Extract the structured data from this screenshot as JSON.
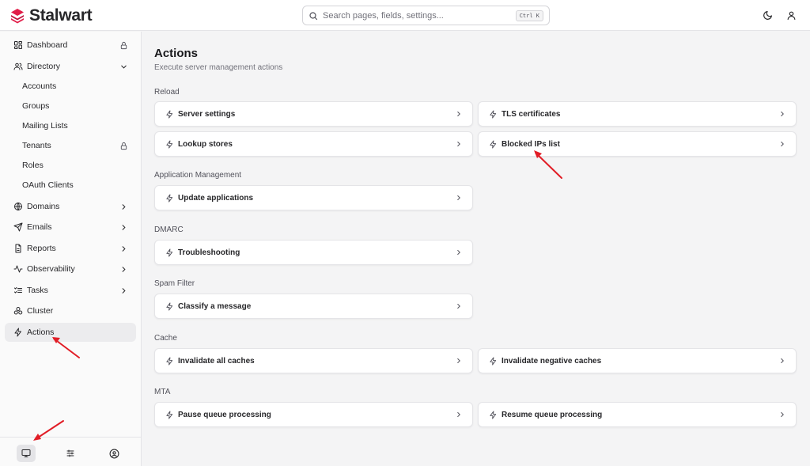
{
  "app": {
    "name": "Stalwart",
    "brand_color": "#e11d48"
  },
  "search": {
    "placeholder": "Search pages, fields, settings...",
    "shortcut": "Ctrl K"
  },
  "header": {
    "icons": [
      "moon-icon",
      "user-icon"
    ]
  },
  "sidebar": {
    "items": [
      {
        "label": "Dashboard",
        "icon": "dashboard-icon",
        "right": "lock-icon"
      },
      {
        "label": "Directory",
        "icon": "users-icon",
        "right": "chevron-down-icon"
      },
      {
        "label": "Accounts"
      },
      {
        "label": "Groups"
      },
      {
        "label": "Mailing Lists"
      },
      {
        "label": "Tenants",
        "right": "lock-icon"
      },
      {
        "label": "Roles"
      },
      {
        "label": "OAuth Clients"
      },
      {
        "label": "Domains",
        "icon": "globe-icon",
        "right": "chevron-right-icon"
      },
      {
        "label": "Emails",
        "icon": "send-icon",
        "right": "chevron-right-icon"
      },
      {
        "label": "Reports",
        "icon": "file-icon",
        "right": "chevron-right-icon"
      },
      {
        "label": "Observability",
        "icon": "activity-icon",
        "right": "chevron-right-icon"
      },
      {
        "label": "Tasks",
        "icon": "list-checks-icon",
        "right": "chevron-right-icon"
      },
      {
        "label": "Cluster",
        "icon": "cluster-icon"
      },
      {
        "label": "Actions",
        "icon": "zap-icon",
        "active": true
      }
    ],
    "footer": [
      "monitor-icon",
      "sliders-icon",
      "user-circle-icon"
    ]
  },
  "main": {
    "title": "Actions",
    "subtitle": "Execute server management actions",
    "sections": [
      {
        "label": "Reload",
        "actions": [
          "Server settings",
          "TLS certificates",
          "Lookup stores",
          "Blocked IPs list"
        ]
      },
      {
        "label": "Application Management",
        "actions": [
          "Update applications"
        ]
      },
      {
        "label": "DMARC",
        "actions": [
          "Troubleshooting"
        ]
      },
      {
        "label": "Spam Filter",
        "actions": [
          "Classify a message"
        ]
      },
      {
        "label": "Cache",
        "actions": [
          "Invalidate all caches",
          "Invalidate negative caches"
        ]
      },
      {
        "label": "MTA",
        "actions": [
          "Pause queue processing",
          "Resume queue processing"
        ]
      }
    ]
  },
  "annotation_color": "#e11d26"
}
